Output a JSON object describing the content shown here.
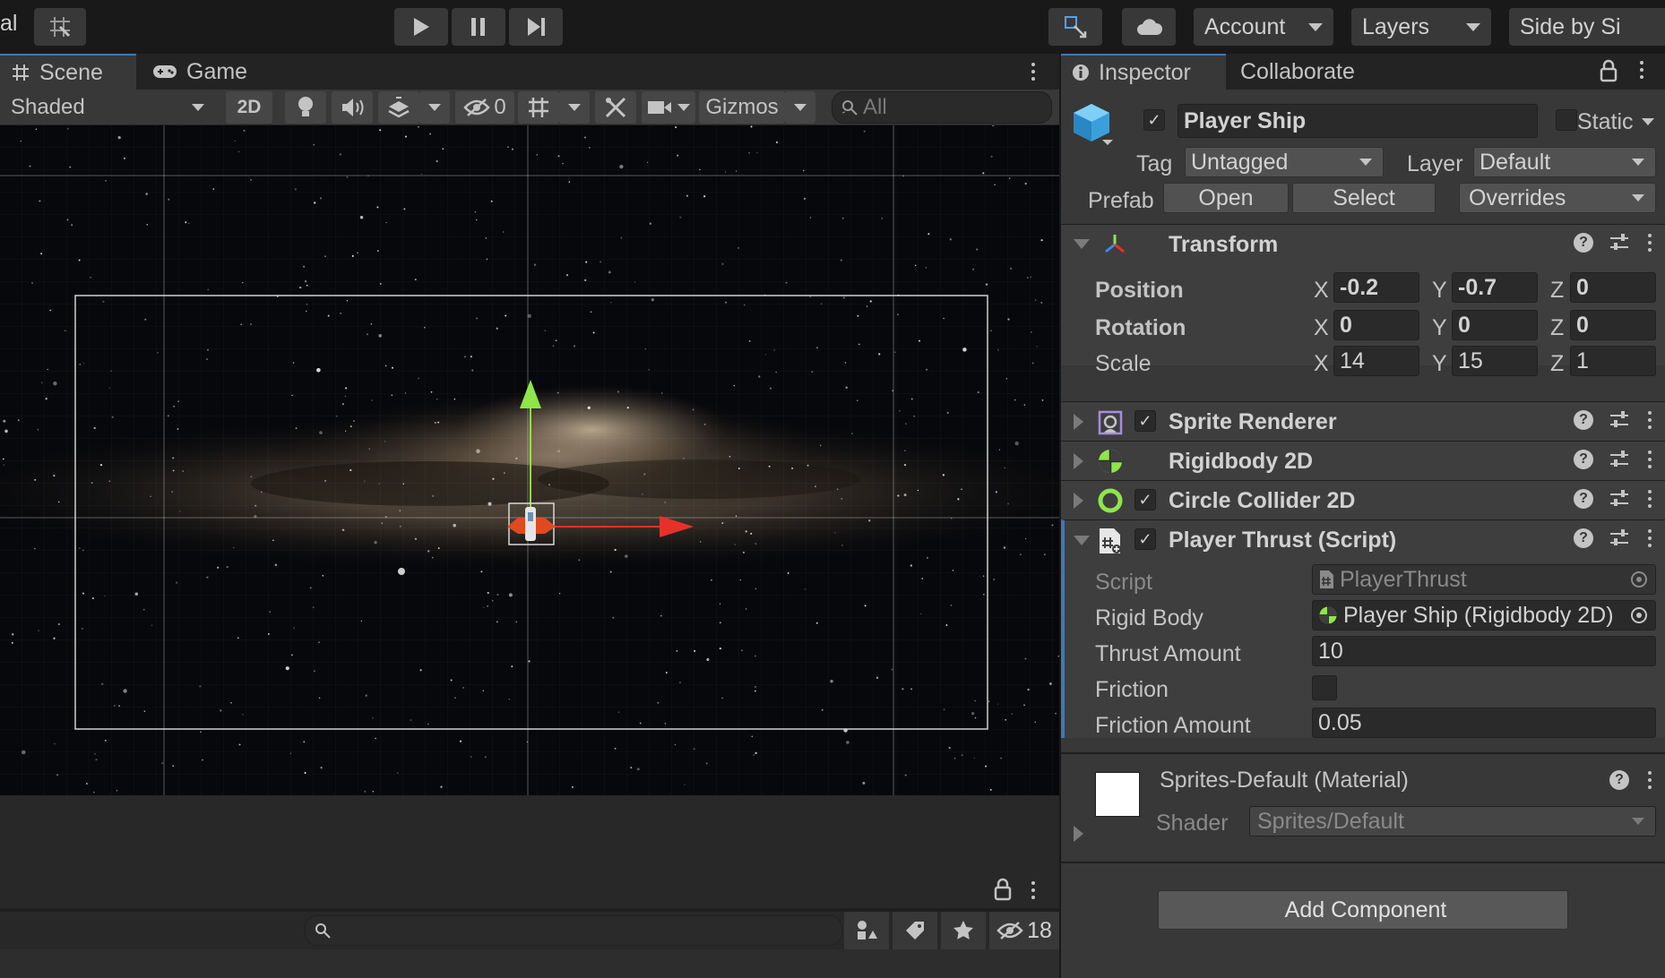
{
  "toolbar": {
    "left_partial_label": "al",
    "account_label": "Account",
    "layers_label": "Layers",
    "layout_label": "Side by Si"
  },
  "scene_panel": {
    "tabs": [
      {
        "label": "Scene"
      },
      {
        "label": "Game"
      }
    ],
    "shading_mode": "Shaded",
    "mode_2d_label": "2D",
    "hidden_count": "0",
    "gizmos_label": "Gizmos",
    "search_placeholder": "All"
  },
  "bottom_panel": {
    "hidden_count": "18"
  },
  "inspector": {
    "tabs": [
      {
        "label": "Inspector"
      },
      {
        "label": "Collaborate"
      }
    ],
    "object_name": "Player Ship",
    "static_label": "Static",
    "tag_label": "Tag",
    "tag_value": "Untagged",
    "layer_label": "Layer",
    "layer_value": "Default",
    "prefab_label": "Prefab",
    "prefab_open": "Open",
    "prefab_select": "Select",
    "prefab_overrides": "Overrides",
    "transform": {
      "title": "Transform",
      "position_label": "Position",
      "rotation_label": "Rotation",
      "scale_label": "Scale",
      "position": {
        "x": "-0.2",
        "y": "-0.7",
        "z": "0"
      },
      "rotation": {
        "x": "0",
        "y": "0",
        "z": "0"
      },
      "scale": {
        "x": "14",
        "y": "15",
        "z": "1"
      }
    },
    "axis_labels": {
      "x": "X",
      "y": "Y",
      "z": "Z"
    },
    "components": {
      "sprite_renderer": "Sprite Renderer",
      "rigidbody": "Rigidbody 2D",
      "circle_collider": "Circle Collider 2D",
      "player_thrust": "Player Thrust (Script)"
    },
    "player_thrust": {
      "script_label": "Script",
      "script_value": "PlayerThrust",
      "rigid_body_label": "Rigid Body",
      "rigid_body_value": "Player Ship (Rigidbody 2D)",
      "thrust_amount_label": "Thrust Amount",
      "thrust_amount_value": "10",
      "friction_label": "Friction",
      "friction_amount_label": "Friction Amount",
      "friction_amount_value": "0.05"
    },
    "material": {
      "title": "Sprites-Default (Material)",
      "shader_label": "Shader",
      "shader_value": "Sprites/Default"
    },
    "add_component_label": "Add Component"
  },
  "icons": [
    "play-icon",
    "pause-icon",
    "step-icon",
    "grid-snap-icon",
    "collab-icon",
    "cloud-icon",
    "scene-grid-icon",
    "gamepad-icon",
    "light-icon",
    "audio-icon",
    "effects-icon",
    "hidden-eye-icon",
    "grid-icon",
    "tools-icon",
    "camera-icon",
    "search-icon",
    "info-icon",
    "lock-icon",
    "cube-icon",
    "transform-icon",
    "sprite-renderer-icon",
    "rigidbody-icon",
    "circle-collider-icon",
    "script-icon",
    "help-icon",
    "presets-icon",
    "kebab-icon",
    "object-picker-icon"
  ]
}
